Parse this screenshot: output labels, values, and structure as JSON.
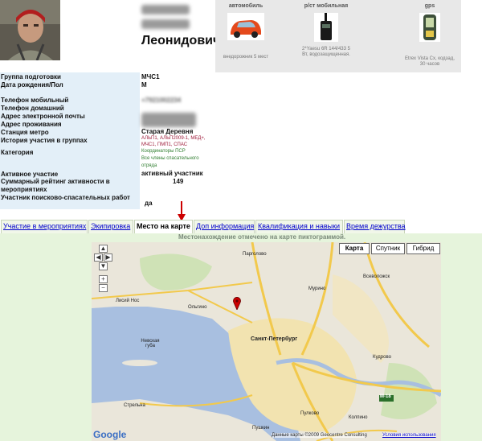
{
  "profile": {
    "surname_line": "Леонидович"
  },
  "equipment": [
    {
      "title": "автомобиль",
      "desc": "внедорожник 5 мест"
    },
    {
      "title": "р/ст мобильная",
      "desc": "2*Yaesu 6R 144/433 5 Вт, водозащищенная."
    },
    {
      "title": "gps",
      "desc": "Etrex Vista Cx, кодзад, 30 часов"
    }
  ],
  "fields": {
    "group_label": "Группа подготовки",
    "group_value": "МЧС1",
    "birth_label": "Дата рождения/Пол",
    "birth_value": "М",
    "phone_mobile_label": "Телефон мобильный",
    "phone_mobile_value": "+7921002234",
    "phone_home_label": "Телефон домашний",
    "email_label": "Адрес электронной почты",
    "address_label": "Адрес проживания",
    "metro_label": "Станция метро",
    "metro_value": "Старая Деревня",
    "history_label": "История участия в группах",
    "history_value": "АЛЬП1, АЛЬП2009-1, МЕД+,",
    "history_value2": "МЧС1, ПМП1, СПАС",
    "category_label": "Категория",
    "category_value1": "Координаторы ПСР",
    "category_value2": "Все члены спасательного",
    "category_value3": "отряда",
    "active_label": "Активное участие",
    "active_value": "активный участник",
    "rating_label": "Суммарный рейтинг активности в мероприятиях",
    "rating_value": "149",
    "rescue_label": "Участник поисково-спасательных работ",
    "rescue_value": "да"
  },
  "tabs": [
    "Участие в мероприятиях",
    "Экипировка",
    "Место на карте",
    "Доп информация",
    "Квалификация и навыки",
    "Время дежурства"
  ],
  "map": {
    "note": "Местонахождение отмечено на карте пиктограммой.",
    "types": [
      "Карта",
      "Спутник",
      "Гибрид"
    ],
    "places": {
      "spb": "Санкт-Петербург",
      "nevskaya": "Невская губа",
      "pargolovo": "Парголово",
      "murino": "Мурино",
      "vsevolozhsk": "Всеволожск",
      "olgino": "Ольгино",
      "lisiy_nos": "Лисий Нос",
      "kolpino": "Колпино",
      "pushkin": "Пушкин",
      "pulkovo": "Пулково",
      "strelna": "Стрельна",
      "kudrovo": "Кудрово",
      "m18": "M-18"
    },
    "google": "Google",
    "attribution": "Данные карты ©2009 Geocentre Consulting",
    "terms": "Условия использования"
  },
  "colors": {
    "label_bg": "#e3eff8",
    "map_panel_bg": "#e6f4dc",
    "link": "#0000cc",
    "marker": "#cc0000"
  }
}
